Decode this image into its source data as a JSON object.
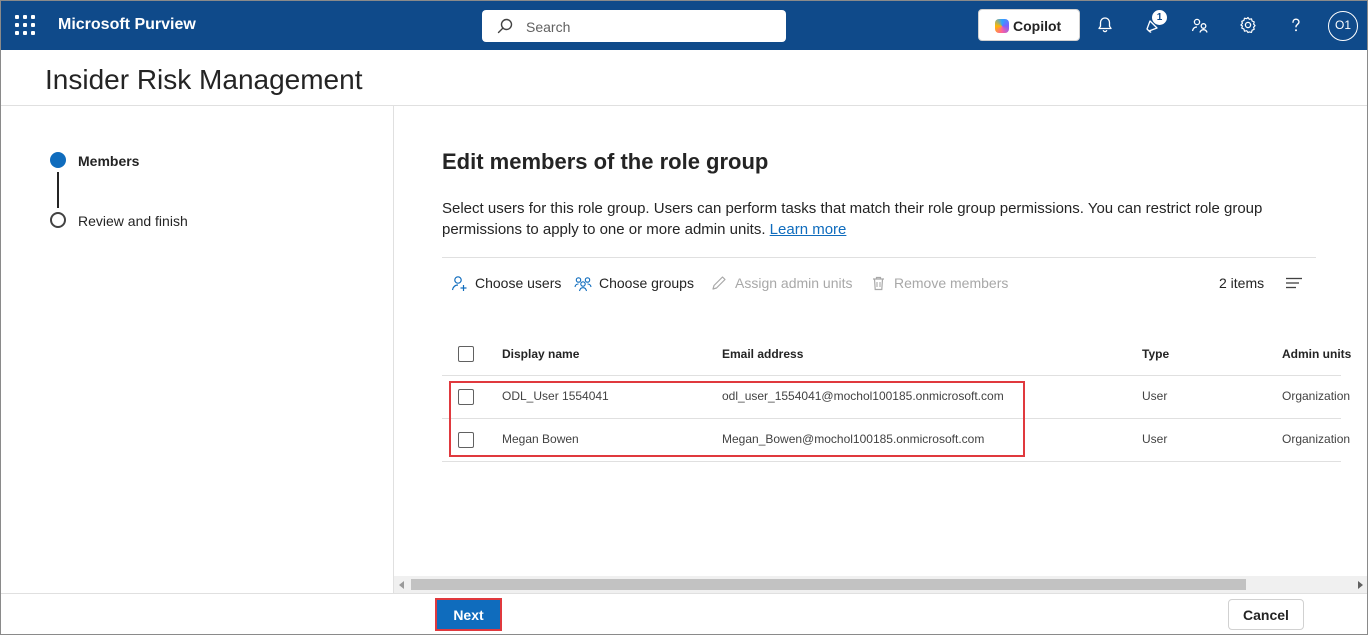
{
  "app": {
    "name": "Microsoft Purview",
    "search_placeholder": "Search",
    "copilot_label": "Copilot",
    "notification_count": "1",
    "avatar_initials": "O1",
    "brand_color": "#0f4a8a",
    "accent_color": "#0f6cbd"
  },
  "page": {
    "title": "Insider Risk Management"
  },
  "steps": [
    {
      "label": "Members",
      "state": "current"
    },
    {
      "label": "Review and finish",
      "state": "pending"
    }
  ],
  "main": {
    "title": "Edit members of the role group",
    "description": "Select users for this role group. Users can perform tasks that match their role group permissions. You can restrict role group permissions to apply to one or more admin units.",
    "learn_more": "Learn more"
  },
  "toolbar": {
    "choose_users": "Choose users",
    "choose_groups": "Choose groups",
    "assign_admin_units": "Assign admin units",
    "remove_members": "Remove members",
    "items_count": "2 items"
  },
  "table": {
    "columns": [
      "Display name",
      "Email address",
      "Type",
      "Admin units"
    ],
    "rows": [
      {
        "display_name": "ODL_User 1554041",
        "email": "odl_user_1554041@mochol100185.onmicrosoft.com",
        "type": "User",
        "admin_units": "Organization"
      },
      {
        "display_name": "Megan Bowen",
        "email": "Megan_Bowen@mochol100185.onmicrosoft.com",
        "type": "User",
        "admin_units": "Organization"
      }
    ]
  },
  "footer": {
    "next_label": "Next",
    "cancel_label": "Cancel"
  }
}
